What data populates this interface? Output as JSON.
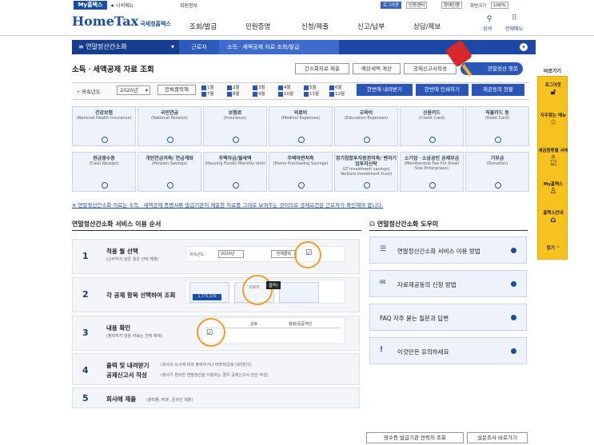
{
  "topbar": {
    "my_hometax": "My홈택스",
    "my_menu": "★ 나의메뉴",
    "member_info": "회원정보",
    "logout": "로그아웃",
    "cert_center": "인증센터",
    "disability": "장애인용",
    "zoom_label": "화면크기",
    "zoom_value": "100%"
  },
  "header": {
    "logo": "HomeTax",
    "logo_sub": "국세청홈택스",
    "gnb": [
      "조회/발급",
      "민원증명",
      "신청/제출",
      "신고/납부",
      "상담/제보"
    ],
    "search": "검색",
    "all_menu": "전체메뉴"
  },
  "nav": {
    "menu": "연말정산간소화",
    "crumb1": "근로자",
    "crumb2": "소득ㆍ세액공제 자료 조회/발급"
  },
  "page": {
    "title": "소득ㆍ세액공제 자료 조회",
    "btn1": "간소화자료 제출",
    "btn2": "예상세액 계산",
    "btn3": "공제신고서작성",
    "btn4": "연말정산 챗봇"
  },
  "yearbar": {
    "label": "귀속년도",
    "year": "2020년",
    "select_all": "전체클릭해",
    "months": [
      "1월",
      "2월",
      "3월",
      "4월",
      "5월",
      "6월",
      "7월",
      "8월",
      "9월",
      "10월",
      "11월",
      "12월"
    ],
    "download": "한번에 내려받기",
    "print": "한번에 인쇄하기",
    "status": "제공동의 현황"
  },
  "categories": [
    {
      "ko": "건강보험",
      "en": "(National Health Insurance)"
    },
    {
      "ko": "국민연금",
      "en": "(National Pension)"
    },
    {
      "ko": "보험료",
      "en": "(Insurance)"
    },
    {
      "ko": "의료비",
      "en": "(Medical Expenses)"
    },
    {
      "ko": "교육비",
      "en": "(Education Expenses)"
    },
    {
      "ko": "신용카드",
      "en": "(Credit Card)"
    },
    {
      "ko": "직불카드 등",
      "en": "(Debit Card)"
    },
    {
      "ko": "현금영수증",
      "en": "(Cash Receipt)"
    },
    {
      "ko": "개인연금저축/ 연금계좌",
      "en": "(Pension Savings)"
    },
    {
      "ko": "주택자금/월세액",
      "en": "(Housing Funds/ Monthly rent)"
    },
    {
      "ko": "주택마련저축",
      "en": "(Home Purchasing Savings)"
    },
    {
      "ko": "장기집합투자증권저축/ 벤처기업투자신탁",
      "en": "(LT investment savings/ Venture investment trust)"
    },
    {
      "ko": "소기업ㆍ소상공인 공제부금",
      "en": "(Membership Fee For Small Size Enterprises)"
    },
    {
      "ko": "기부금",
      "en": "(Donation)"
    }
  ],
  "notice": "※ 연말정산간소화 자료는 소득ㆍ세액공제 증명서류 발급기관이 제출한 자료를 그대로 보여주는 것이므로 공제요건은 근로자가 확인해야 합니다.",
  "steps_title": "연말정산간소화 서비스 이용 순서",
  "steps": [
    {
      "num": "1",
      "title": "적용 월 선택",
      "sub": "(근무하지 않은 월은 선택 해제)"
    },
    {
      "num": "2",
      "title": "각 공제 항목 선택하여 조회",
      "sub": ""
    },
    {
      "num": "3",
      "title": "내용 확인",
      "sub": "(출력하지 않을 자료는 선택 해제)"
    },
    {
      "num": "4",
      "title": "출력 및 내려받기",
      "sub": "(회사의 요구에 따라 출력하거나 PDF파일로 내려받기)",
      "title2": "공제신고서 작성",
      "sub2": "(회사가 편리한 연말정산을 이용하는 경우 공제신고서 전산 작성)"
    },
    {
      "num": "5",
      "title": "회사에 제출",
      "sub": "(출력물, PDF, 온라인 제출)"
    }
  ],
  "step_ui": {
    "year_label": "귀속년도",
    "year": "2020년",
    "select_all": "전체클릭",
    "click": "클릭!",
    "medical": "의료비",
    "amount": "1,775,170",
    "col1": "상호",
    "col2": "월정/공공개인"
  },
  "help_title": "연말정산간소화 도우미",
  "help": [
    {
      "icon": "doc-icon",
      "label": "연말정산간소화 서비스 이용 방법"
    },
    {
      "icon": "msg-icon",
      "label": "자료제공동의 신청 방법"
    },
    {
      "icon": "faq-icon",
      "label": "FAQ 자주 묻는 질문과 답변"
    },
    {
      "icon": "warn-icon",
      "label": "이것만은 유의하세요"
    }
  ],
  "sidebar": {
    "title": "바로가기",
    "items": [
      "로그아웃",
      "자주찾는 메뉴",
      "세금종류별 서비스",
      "My홈택스",
      "홈택스안내",
      "접기"
    ]
  },
  "bottom": {
    "btn1": "영수증 발급기관 연락처 조회",
    "btn2": "설문조사 바로가기"
  }
}
